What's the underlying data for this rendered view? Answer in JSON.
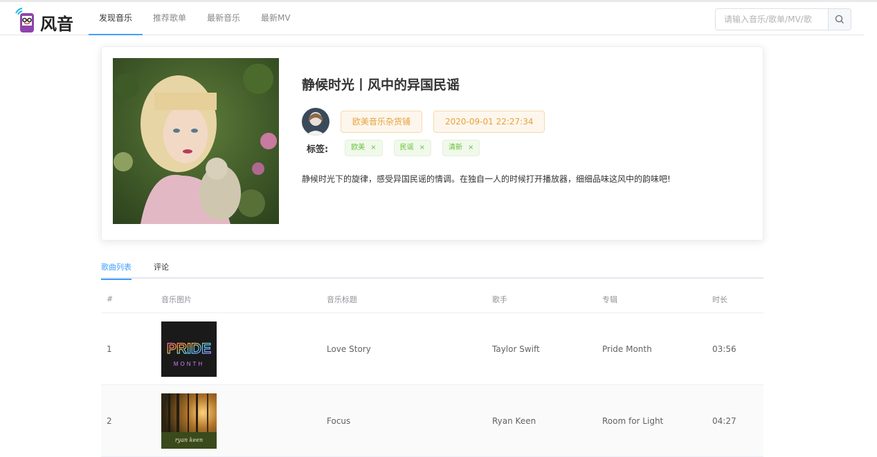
{
  "header": {
    "logo_text": "风音",
    "nav": [
      {
        "label": "发现音乐",
        "active": true
      },
      {
        "label": "推荐歌单",
        "active": false
      },
      {
        "label": "最新音乐",
        "active": false
      },
      {
        "label": "最新MV",
        "active": false
      }
    ],
    "search_placeholder": "请输入音乐/歌单/MV/歌"
  },
  "playlist": {
    "title": "静候时光丨风中的异国民谣",
    "creator": "欧美音乐杂货铺",
    "created_time": "2020-09-01 22:27:34",
    "tags_label": "标签:",
    "tags": [
      "欧美",
      "民谣",
      "清新"
    ],
    "description": "静候时光下的旋律，感受异国民谣的情调。在独自一人的时候打开播放器，细细品味这风中的韵味吧!"
  },
  "tabs": [
    {
      "label": "歌曲列表",
      "active": true
    },
    {
      "label": "评论",
      "active": false
    }
  ],
  "table": {
    "headers": [
      "#",
      "音乐图片",
      "音乐标题",
      "歌手",
      "专辑",
      "时长"
    ],
    "rows": [
      {
        "index": "1",
        "title": "Love Story",
        "artist": "Taylor Swift",
        "album": "Pride Month",
        "duration": "03:56",
        "cover_text_1": "PRIDE",
        "cover_text_2": "MONTH"
      },
      {
        "index": "2",
        "title": "Focus",
        "artist": "Ryan Keen",
        "album": "Room for Light",
        "duration": "04:27",
        "cover_text_1": "ryan keen"
      }
    ]
  },
  "colors": {
    "accent": "#409eff",
    "warning": "#e6a23c",
    "success": "#67c23a"
  }
}
